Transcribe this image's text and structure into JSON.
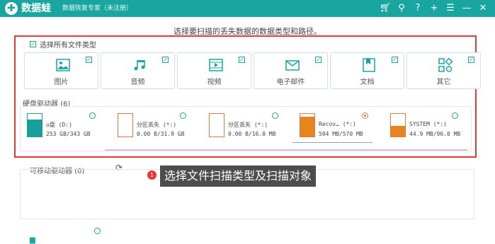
{
  "titlebar": {
    "logo_mark": "✚",
    "app_name": "数据蛙",
    "subtitle": "数据恢复专家（未注册）",
    "icons": [
      "cart-icon",
      "pin-icon",
      "help-icon",
      "plus-icon",
      "menu-icon",
      "minimize-icon",
      "close-icon"
    ]
  },
  "heading": "选择要扫描的丢失数据的数据类型和路径。",
  "select_all": {
    "label": "选择所有文件类型",
    "checked": true
  },
  "file_types": [
    {
      "label": "图片",
      "checked": true,
      "icon": "image-icon"
    },
    {
      "label": "音频",
      "checked": true,
      "icon": "music-icon"
    },
    {
      "label": "视频",
      "checked": true,
      "icon": "video-icon"
    },
    {
      "label": "电子邮件",
      "checked": true,
      "icon": "mail-icon"
    },
    {
      "label": "文档",
      "checked": true,
      "icon": "document-icon"
    },
    {
      "label": "其它",
      "checked": true,
      "icon": "other-icon"
    }
  ],
  "hard_drives": {
    "heading": "硬盘驱动器 (6)",
    "items": [
      {
        "name": "u盘 (D:)",
        "size": "253 GB/343 GB",
        "used_fraction": 0.74,
        "fill_color": "#1a9e9a",
        "selected": false
      },
      {
        "name": "分区丢失 (*:)",
        "size": "0.00  B/31.9 GB",
        "used_fraction": 0,
        "fill_color": "#e8841c",
        "selected": false
      },
      {
        "name": "分区丢失 (*:)",
        "size": "0.00  B/16.0 MB",
        "used_fraction": 0,
        "fill_color": "#e8841c",
        "selected": false
      },
      {
        "name": "Recov… (*:)",
        "size": "504 MB/570 MB",
        "used_fraction": 0.88,
        "fill_color": "#e8841c",
        "selected": true
      },
      {
        "name": "SYSTEM (*:)",
        "size": "44.9 MB/96.0 MB",
        "used_fraction": 0.47,
        "fill_color": "#e8841c",
        "selected": false
      }
    ]
  },
  "removable": {
    "heading": "可移动驱动器 (0)"
  },
  "tip": {
    "number": "1",
    "text": "选择文件扫描类型及扫描对象"
  }
}
